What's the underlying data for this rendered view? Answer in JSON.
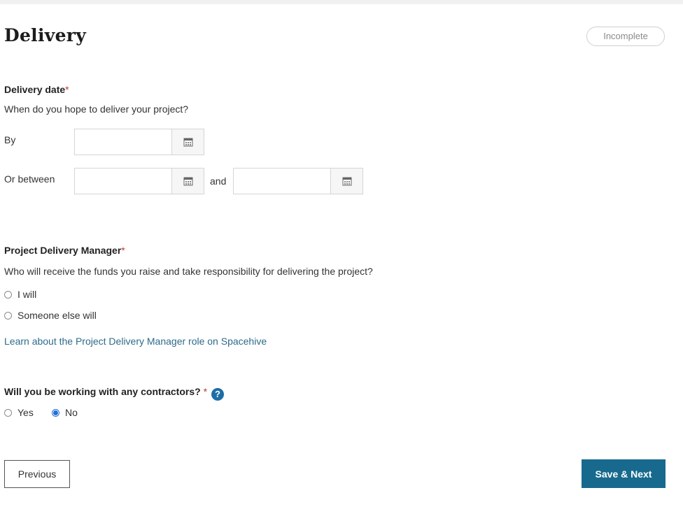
{
  "header": {
    "title": "Delivery",
    "status_badge": "Incomplete"
  },
  "delivery_date": {
    "label": "Delivery date",
    "required_mark": "*",
    "question": "When do you hope to deliver your project?",
    "by_label": "By",
    "between_label": "Or between",
    "and_label": "and",
    "by_value": "",
    "start_value": "",
    "end_value": ""
  },
  "pdm": {
    "label": "Project Delivery Manager",
    "required_mark": "*",
    "question": "Who will receive the funds you raise and take responsibility for delivering the project?",
    "options": [
      {
        "label": "I will",
        "selected": false
      },
      {
        "label": "Someone else will",
        "selected": false
      }
    ],
    "learn_link": "Learn about the Project Delivery Manager role on Spacehive"
  },
  "contractors": {
    "label": "Will you be working with any contractors?",
    "required_mark": "*",
    "help_icon": "?",
    "options": [
      {
        "label": "Yes",
        "selected": false
      },
      {
        "label": "No",
        "selected": true
      }
    ]
  },
  "footer": {
    "previous_label": "Previous",
    "next_label": "Save & Next"
  },
  "colors": {
    "accent": "#176a8d",
    "link": "#2d6b8b",
    "required": "#c0392b",
    "radio_selected": "#1f6fd6"
  }
}
